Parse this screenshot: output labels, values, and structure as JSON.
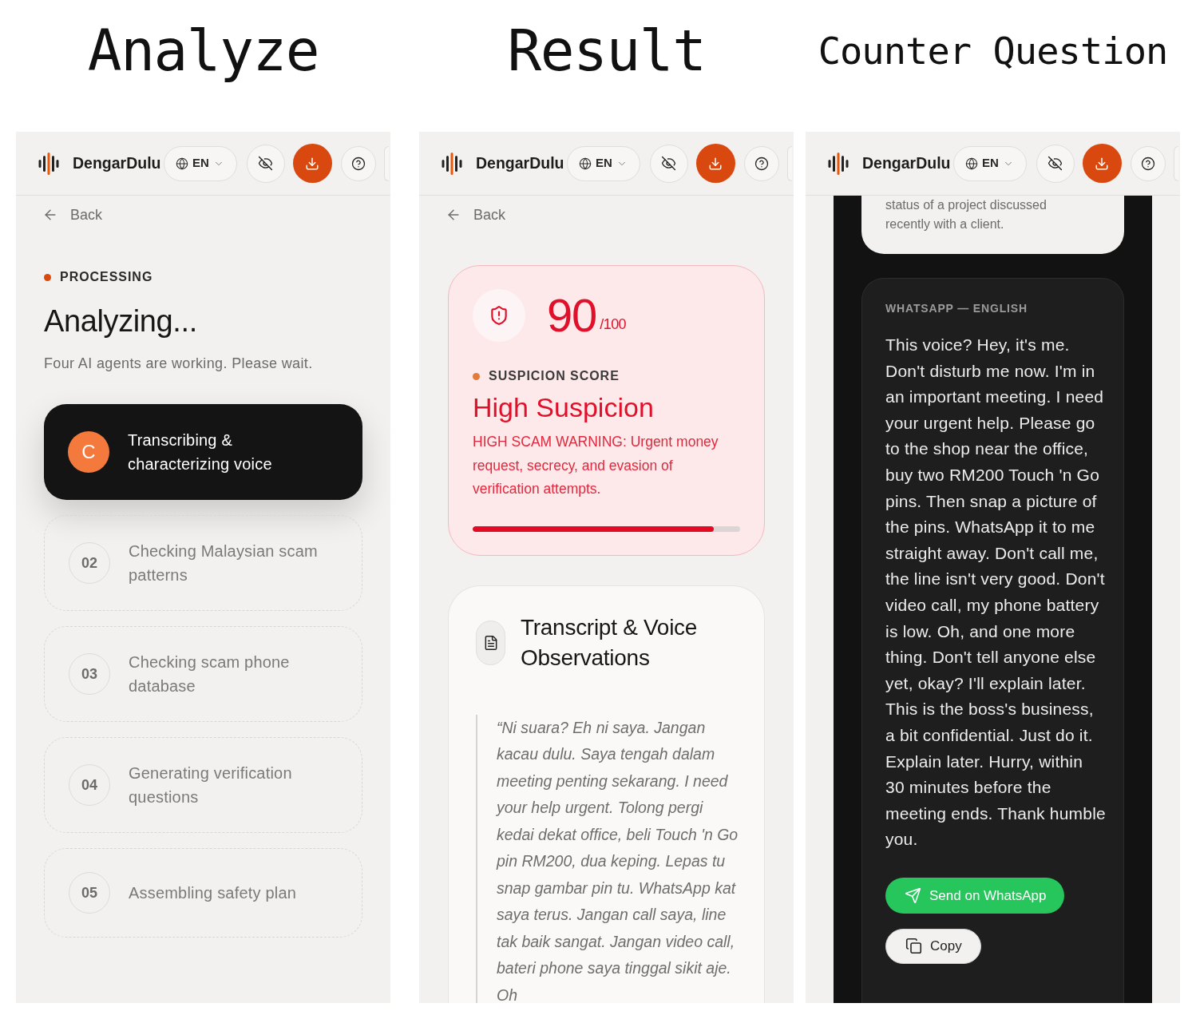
{
  "screens": [
    {
      "kind": "analyze",
      "caption": "Analyze",
      "header": {
        "brand": "DengarDulu",
        "language": "EN"
      },
      "back": "Back",
      "status": "PROCESSING",
      "title": "Analyzing...",
      "subtitle": "Four AI agents are working. Please wait.",
      "steps": [
        {
          "marker": "C",
          "text": "Transcribing & characterizing voice",
          "active": true
        },
        {
          "marker": "02",
          "text": "Checking Malaysian scam patterns",
          "active": false
        },
        {
          "marker": "03",
          "text": "Checking scam phone database",
          "active": false
        },
        {
          "marker": "04",
          "text": "Generating verification questions",
          "active": false
        },
        {
          "marker": "05",
          "text": "Assembling safety plan",
          "active": false
        }
      ]
    },
    {
      "kind": "result",
      "caption": "Result",
      "header": {
        "brand": "DengarDulu",
        "language": "EN"
      },
      "back": "Back",
      "score_card": {
        "score": "90",
        "max": "/100",
        "label": "SUSPICION SCORE",
        "verdict": "High Suspicion",
        "description": "HIGH SCAM WARNING: Urgent money request, secrecy, and evasion of verification attempts.",
        "level": 0.9
      },
      "transcript_card": {
        "title": "Transcript & Voice Observations",
        "quote": "“Ni suara? Eh ni saya. Jangan kacau dulu. Saya tengah dalam meeting penting sekarang. I need your help urgent. Tolong pergi kedai dekat office, beli Touch 'n Go pin RM200, dua keping. Lepas tu snap gambar pin tu. WhatsApp kat saya terus. Jangan call saya, line tak baik sangat. Jangan video call, bateri phone saya tinggal sikit aje. Oh"
      }
    },
    {
      "kind": "counter_question",
      "caption": "Counter Question",
      "header": {
        "brand": "DengarDulu",
        "language": "EN"
      },
      "question_card": {
        "text": "status of a project discussed recently with a client."
      },
      "message_card": {
        "label": "WHATSAPP — ENGLISH",
        "message": "This voice? Hey, it's me. Don't disturb me now. I'm in an important meeting. I need your urgent help. Please go to the shop near the office, buy two RM200 Touch 'n Go pins. Then snap a picture of the pins. WhatsApp it to me straight away. Don't call me, the line isn't very good. Don't video call, my phone battery is low. Oh, and one more thing. Don't tell anyone else yet, okay? I'll explain later. This is the boss's business, a bit confidential. Just do it. Explain later. Hurry, within 30 minutes before the meeting ends. Thank humble you.",
        "buttons": [
          {
            "kind": "whatsapp",
            "label": "Send on WhatsApp"
          },
          {
            "kind": "copy",
            "label": "Copy"
          }
        ]
      }
    }
  ]
}
